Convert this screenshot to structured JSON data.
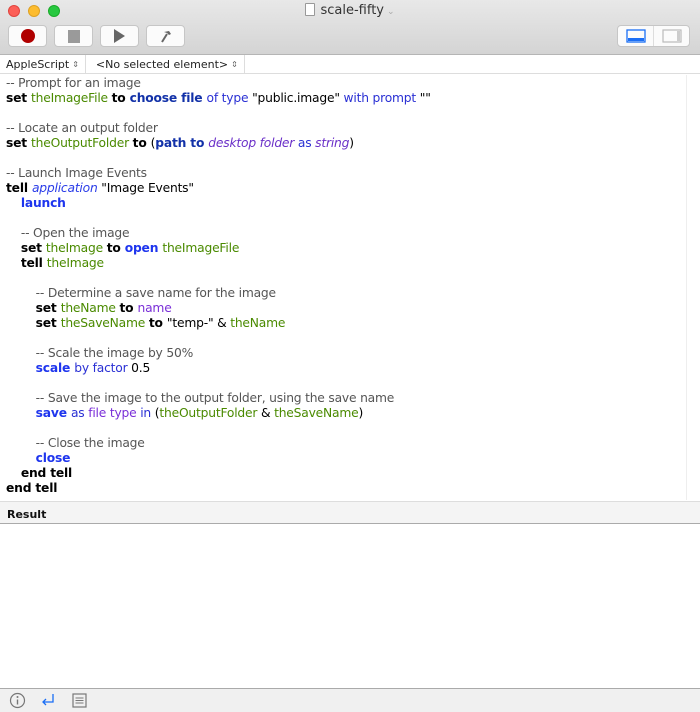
{
  "window": {
    "title": "scale-fifty"
  },
  "toolbar": {
    "record": "record-button",
    "stop": "stop-button",
    "run": "run-button",
    "compile": "compile-button"
  },
  "navigator": {
    "language": "AppleScript",
    "element": "<No selected element>"
  },
  "code": [
    [
      [
        "cm",
        "-- Prompt for an image"
      ]
    ],
    [
      [
        "kw",
        "set "
      ],
      [
        "var",
        "theImageFile "
      ],
      [
        "kw",
        "to "
      ],
      [
        "cmd",
        "choose file "
      ],
      [
        "prm",
        "of type "
      ],
      [
        "str",
        "\"public.image\" "
      ],
      [
        "prm",
        "with prompt "
      ],
      [
        "str",
        "\"\""
      ]
    ],
    [],
    [
      [
        "cm",
        "-- Locate an output folder"
      ]
    ],
    [
      [
        "kw",
        "set "
      ],
      [
        "var",
        "theOutputFolder "
      ],
      [
        "kw",
        "to "
      ],
      [
        "op",
        "("
      ],
      [
        "cmd",
        "path to "
      ],
      [
        "propi",
        "desktop folder "
      ],
      [
        "prm",
        "as "
      ],
      [
        "propi",
        "string"
      ],
      [
        "op",
        ")"
      ]
    ],
    [],
    [
      [
        "cm",
        "-- Launch Image Events"
      ]
    ],
    [
      [
        "kw",
        "tell "
      ],
      [
        "cls",
        "application "
      ],
      [
        "str",
        "\"Image Events\""
      ]
    ],
    [
      [
        "op",
        "\t"
      ],
      [
        "cmdb",
        "launch"
      ]
    ],
    [],
    [
      [
        "op",
        "\t"
      ],
      [
        "cm",
        "-- Open the image"
      ]
    ],
    [
      [
        "op",
        "\t"
      ],
      [
        "kw",
        "set "
      ],
      [
        "var",
        "theImage "
      ],
      [
        "kw",
        "to "
      ],
      [
        "cmdb",
        "open "
      ],
      [
        "var",
        "theImageFile"
      ]
    ],
    [
      [
        "op",
        "\t"
      ],
      [
        "kw",
        "tell "
      ],
      [
        "var",
        "theImage"
      ]
    ],
    [],
    [
      [
        "op",
        "\t\t"
      ],
      [
        "cm",
        "-- Determine a save name for the image"
      ]
    ],
    [
      [
        "op",
        "\t\t"
      ],
      [
        "kw",
        "set "
      ],
      [
        "var",
        "theName "
      ],
      [
        "kw",
        "to "
      ],
      [
        "prop",
        "name"
      ]
    ],
    [
      [
        "op",
        "\t\t"
      ],
      [
        "kw",
        "set "
      ],
      [
        "var",
        "theSaveName "
      ],
      [
        "kw",
        "to "
      ],
      [
        "str",
        "\"temp-\" "
      ],
      [
        "op",
        "& "
      ],
      [
        "var",
        "theName"
      ]
    ],
    [],
    [
      [
        "op",
        "\t\t"
      ],
      [
        "cm",
        "-- Scale the image by 50%"
      ]
    ],
    [
      [
        "op",
        "\t\t"
      ],
      [
        "cmdb",
        "scale "
      ],
      [
        "prm",
        "by factor "
      ],
      [
        "str",
        "0.5"
      ]
    ],
    [],
    [
      [
        "op",
        "\t\t"
      ],
      [
        "cm",
        "-- Save the image to the output folder, using the save name"
      ]
    ],
    [
      [
        "op",
        "\t\t"
      ],
      [
        "cmdb",
        "save "
      ],
      [
        "prm",
        "as "
      ],
      [
        "prop",
        "file type "
      ],
      [
        "prm",
        "in "
      ],
      [
        "op",
        "("
      ],
      [
        "var",
        "theOutputFolder "
      ],
      [
        "op",
        "& "
      ],
      [
        "var",
        "theSaveName"
      ],
      [
        "op",
        ")"
      ]
    ],
    [],
    [
      [
        "op",
        "\t\t"
      ],
      [
        "cm",
        "-- Close the image"
      ]
    ],
    [
      [
        "op",
        "\t\t"
      ],
      [
        "cmdb",
        "close"
      ]
    ],
    [
      [
        "op",
        "\t"
      ],
      [
        "kw",
        "end tell"
      ]
    ],
    [
      [
        "kw",
        "end tell"
      ]
    ]
  ],
  "result": {
    "label": "Result",
    "value": ""
  },
  "colors": {
    "record": "#b00000",
    "accent": "#1a6ef5"
  }
}
